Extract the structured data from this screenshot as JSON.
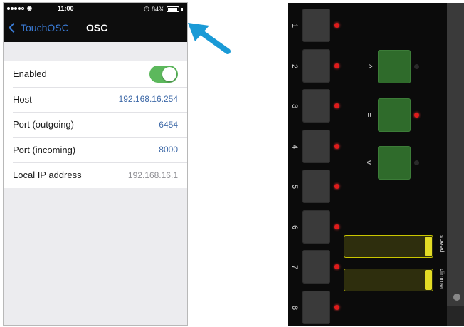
{
  "left_phone": {
    "status_bar": {
      "time": "11:00",
      "battery": "84%"
    },
    "nav": {
      "back_label": "TouchOSC",
      "title": "OSC"
    },
    "settings": [
      {
        "label": "Enabled",
        "type": "toggle",
        "on": true
      },
      {
        "label": "Host",
        "value": "192.168.16.254"
      },
      {
        "label": "Port (outgoing)",
        "value": "6454"
      },
      {
        "label": "Port (incoming)",
        "value": "8000"
      },
      {
        "label": "Local IP address",
        "value": "192.168.16.1"
      }
    ]
  },
  "arrow": {
    "icon": "arrow-pointer-icon",
    "color": "#1a9ad6"
  },
  "right_phone": {
    "pads": [
      {
        "number": "1",
        "led": "on"
      },
      {
        "number": "2",
        "led": "on"
      },
      {
        "number": "3",
        "led": "on"
      },
      {
        "number": "4",
        "led": "on"
      },
      {
        "number": "5",
        "led": "on"
      },
      {
        "number": "6",
        "led": "on"
      },
      {
        "number": "7",
        "led": "on"
      },
      {
        "number": "8",
        "led": "on"
      }
    ],
    "controls": [
      {
        "symbol": "^",
        "led": "off"
      },
      {
        "symbol": "=",
        "led": "on"
      },
      {
        "symbol": "v",
        "led": "off"
      }
    ],
    "faders": [
      {
        "label": "speed",
        "value": 1.0
      },
      {
        "label": "dimmer",
        "value": 1.0
      }
    ],
    "colors": {
      "pad": "#3a3a3a",
      "led_on": "#e01b1b",
      "green_pad": "#2f6b2b",
      "fader_border": "#c9c600",
      "fader_fill": "#e3dc25"
    }
  }
}
